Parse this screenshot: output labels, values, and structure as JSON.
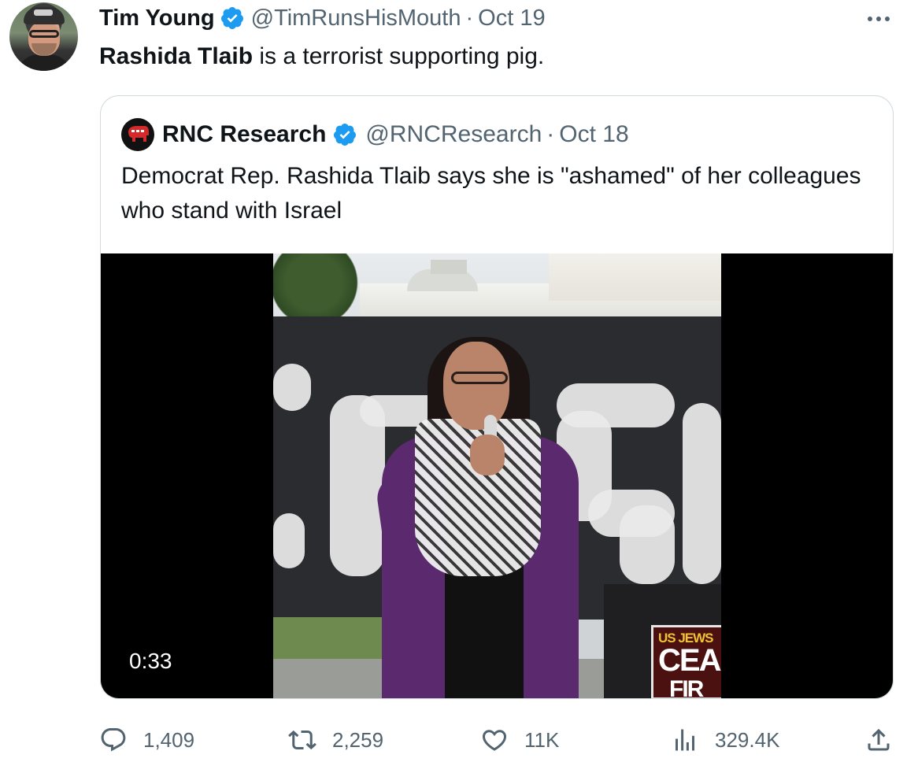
{
  "tweet": {
    "author_name": "Tim Young",
    "handle": "@TimRunsHisMouth",
    "separator": "·",
    "date": "Oct 19",
    "text_bold": "Rashida Tlaib",
    "text_rest": " is a terrorist supporting pig.",
    "more_icon": "more-horizontal-icon"
  },
  "quote": {
    "author_name": "RNC Research",
    "handle": "@RNCResearch",
    "separator": "·",
    "date": "Oct 18",
    "text": "Democrat Rep. Rashida Tlaib says she is \"ashamed\" of her colleagues who stand with Israel",
    "video": {
      "duration": "0:33",
      "sign_line1": "US JEWS",
      "sign_line2": "CEA",
      "sign_line3": "FIR"
    }
  },
  "actions": {
    "replies": "1,409",
    "retweets": "2,259",
    "likes": "11K",
    "views": "329.4K"
  },
  "colors": {
    "text_primary": "#0f1419",
    "text_secondary": "#536471",
    "verified_blue": "#1d9bf0",
    "border": "#cfd9de",
    "rnc_red": "#d42a2a"
  }
}
